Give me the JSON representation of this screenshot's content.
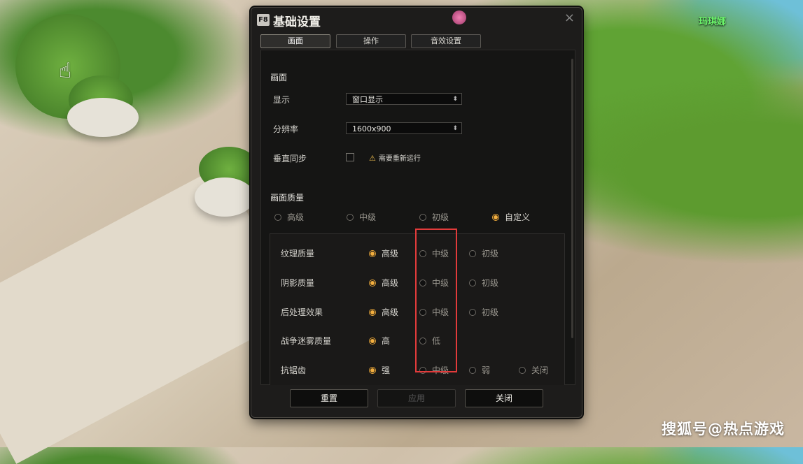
{
  "npc_name": "玛琪娜",
  "watermark": "搜狐号@热点游戏",
  "dialog": {
    "hotkey": "F8",
    "title": "基础设置",
    "close_icon": "×",
    "tabs": [
      "画面",
      "操作",
      "音效设置"
    ],
    "active_tab": 0
  },
  "display": {
    "section": "画面",
    "mode_label": "显示",
    "mode_value": "窗口显示",
    "resolution_label": "分辨率",
    "resolution_value": "1600x900",
    "vsync_label": "垂直同步",
    "vsync_warning": "需要重新运行"
  },
  "quality": {
    "section": "画面质量",
    "presets": [
      "高级",
      "中级",
      "初级",
      "自定义"
    ],
    "selected_preset": "自定义",
    "rows": [
      {
        "label": "纹理质量",
        "options": [
          "高级",
          "中级",
          "初级"
        ],
        "selected": "高级"
      },
      {
        "label": "阴影质量",
        "options": [
          "高级",
          "中级",
          "初级"
        ],
        "selected": "高级"
      },
      {
        "label": "后处理效果",
        "options": [
          "高级",
          "中级",
          "初级"
        ],
        "selected": "高级"
      },
      {
        "label": "战争迷雾质量",
        "options": [
          "高",
          "低"
        ],
        "selected": "高"
      },
      {
        "label": "抗锯齿",
        "options": [
          "强",
          "中级",
          "弱",
          "关闭"
        ],
        "selected": "强"
      }
    ]
  },
  "buttons": {
    "reset": "重置",
    "apply": "应用",
    "close": "关闭"
  }
}
